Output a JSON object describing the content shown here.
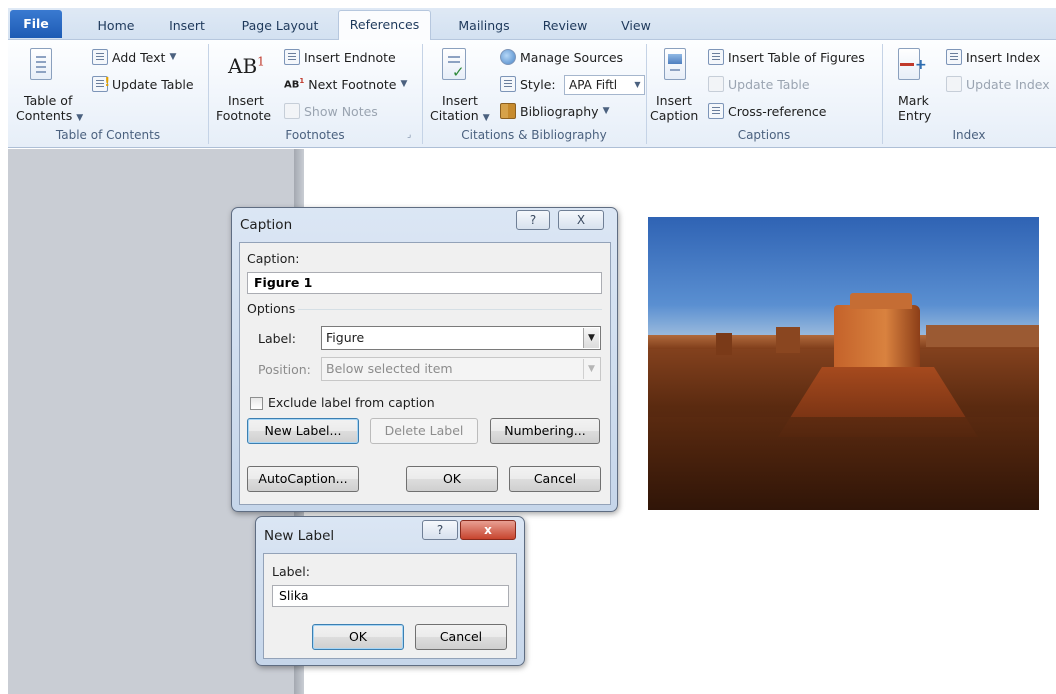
{
  "tabs": {
    "file": "File",
    "home": "Home",
    "insert": "Insert",
    "page_layout": "Page Layout",
    "references": "References",
    "mailings": "Mailings",
    "review": "Review",
    "view": "View"
  },
  "ribbon": {
    "toc": {
      "group_label": "Table of Contents",
      "table_of_contents": [
        "Table of",
        "Contents"
      ],
      "add_text": "Add Text",
      "update_table": "Update Table"
    },
    "footnotes": {
      "group_label": "Footnotes",
      "insert_footnote": [
        "Insert",
        "Footnote"
      ],
      "insert_endnote": "Insert Endnote",
      "next_footnote": "Next Footnote",
      "show_notes": "Show Notes",
      "ab_glyph": "AB",
      "ab_super": "1"
    },
    "citations": {
      "group_label": "Citations & Bibliography",
      "insert_citation": [
        "Insert",
        "Citation"
      ],
      "manage_sources": "Manage Sources",
      "style_label": "Style:",
      "style_value": "APA Fiftl",
      "bibliography": "Bibliography"
    },
    "captions": {
      "group_label": "Captions",
      "insert_caption": [
        "Insert",
        "Caption"
      ],
      "insert_table_of_figures": "Insert Table of Figures",
      "update_table": "Update Table",
      "cross_reference": "Cross-reference"
    },
    "index": {
      "group_label": "Index",
      "mark_entry": [
        "Mark",
        "Entry"
      ],
      "insert_index": "Insert Index",
      "update_index": "Update Index"
    }
  },
  "caption_dialog": {
    "title": "Caption",
    "help": "?",
    "close": "X",
    "caption_label": "Caption:",
    "caption_value": "Figure 1",
    "options_label": "Options",
    "label_label": "Label:",
    "label_value": "Figure",
    "position_label": "Position:",
    "position_value": "Below selected item",
    "exclude_label": "Exclude label from caption",
    "exclude_checked": false,
    "new_label_button": "New Label...",
    "delete_label_button": "Delete Label",
    "numbering_button": "Numbering...",
    "autocaption_button": "AutoCaption...",
    "ok_button": "OK",
    "cancel_button": "Cancel"
  },
  "new_label_dialog": {
    "title": "New Label",
    "help": "?",
    "close": "x",
    "label_label": "Label:",
    "label_value": "Slika",
    "ok_button": "OK",
    "cancel_button": "Cancel"
  },
  "colors": {
    "file_tab": "#1d5bb4",
    "ribbon_bg": "#e6eef8",
    "group_label": "#4b617f",
    "workspace": "#c9cdd4",
    "close_button": "#c7442e"
  },
  "icons": {
    "table_of_contents": "document-lines-icon",
    "add_text": "add-text-icon",
    "update_table": "update-table-icon",
    "insert_endnote": "endnote-icon",
    "next_footnote": "next-footnote-icon",
    "show_notes": "show-notes-icon",
    "insert_citation": "citation-icon",
    "manage_sources": "globe-icon",
    "style": "style-icon",
    "bibliography": "book-icon",
    "insert_caption": "caption-icon",
    "insert_table_of_figures": "table-of-figures-icon",
    "cross_reference": "cross-reference-icon",
    "mark_entry": "mark-entry-icon",
    "insert_index": "index-icon",
    "update_index": "update-index-icon"
  }
}
